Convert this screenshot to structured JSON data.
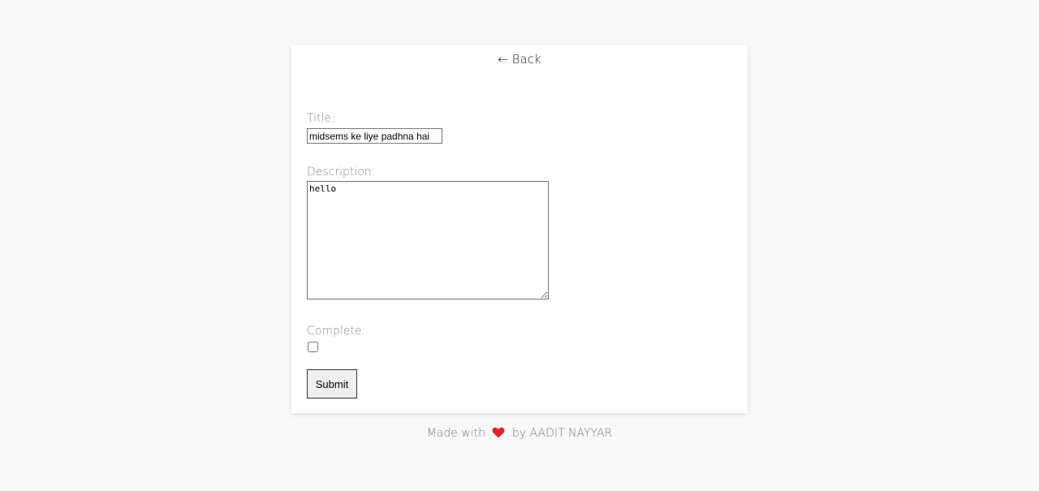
{
  "nav": {
    "back_label": "← Back"
  },
  "form": {
    "title_label": "Title:",
    "title_value": "midsems ke liye padhna hai",
    "description_label": "Description:",
    "description_value": "hello",
    "complete_label": "Complete:",
    "complete_checked": false,
    "submit_label": "Submit"
  },
  "footer": {
    "prefix": "Made with",
    "icon": "heart-icon",
    "suffix": "by AADIT NAYYAR"
  },
  "colors": {
    "background": "#f9f9f9",
    "card": "#ffffff",
    "heart": "#e8232a",
    "label": "#8a8a8a"
  }
}
